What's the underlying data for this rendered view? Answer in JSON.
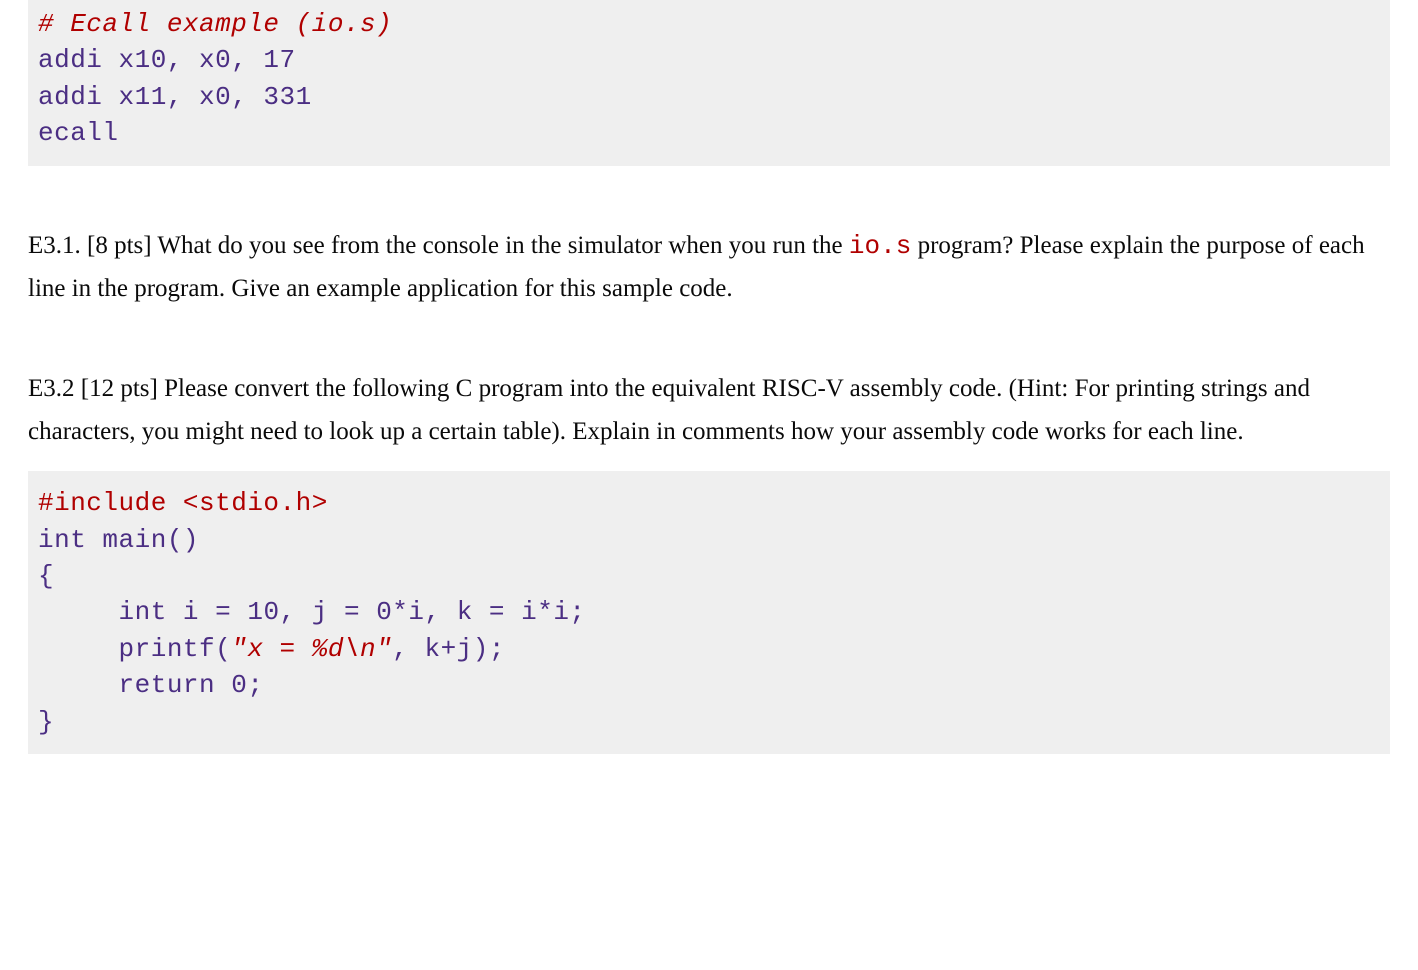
{
  "code1": {
    "comment": "# Ecall example (io.s)",
    "l1": "addi x10, x0, 17",
    "l2": "addi x11, x0, 331",
    "l3": "ecall"
  },
  "q1": {
    "prefix": "E3.1. [8 pts] What do you see from the console in the simulator when you run the ",
    "code_inline": "io.s",
    "suffix": " program? Please explain the purpose of each line in the program. Give an example application for this sample code."
  },
  "q2": {
    "text": "E3.2 [12 pts] Please convert the following C program into the equivalent RISC-V assembly code. (Hint: For printing strings and characters, you might need to look up a certain table). Explain in comments how your assembly code works for each line."
  },
  "code2": {
    "l1": "#include <stdio.h>",
    "l2a": "int",
    "l2b": " main()",
    "l3": "{",
    "l4a": "     int",
    "l4b": " i = ",
    "l4c": "10",
    "l4d": ", j = ",
    "l4e": "0",
    "l4f": "*i, k = i*i;",
    "l5a": "     printf(",
    "l5b": "\"x = %d\\n\"",
    "l5c": ", k+j);",
    "l6a": "     return",
    "l6b": " 0",
    "l6c": ";",
    "l7": "}"
  }
}
